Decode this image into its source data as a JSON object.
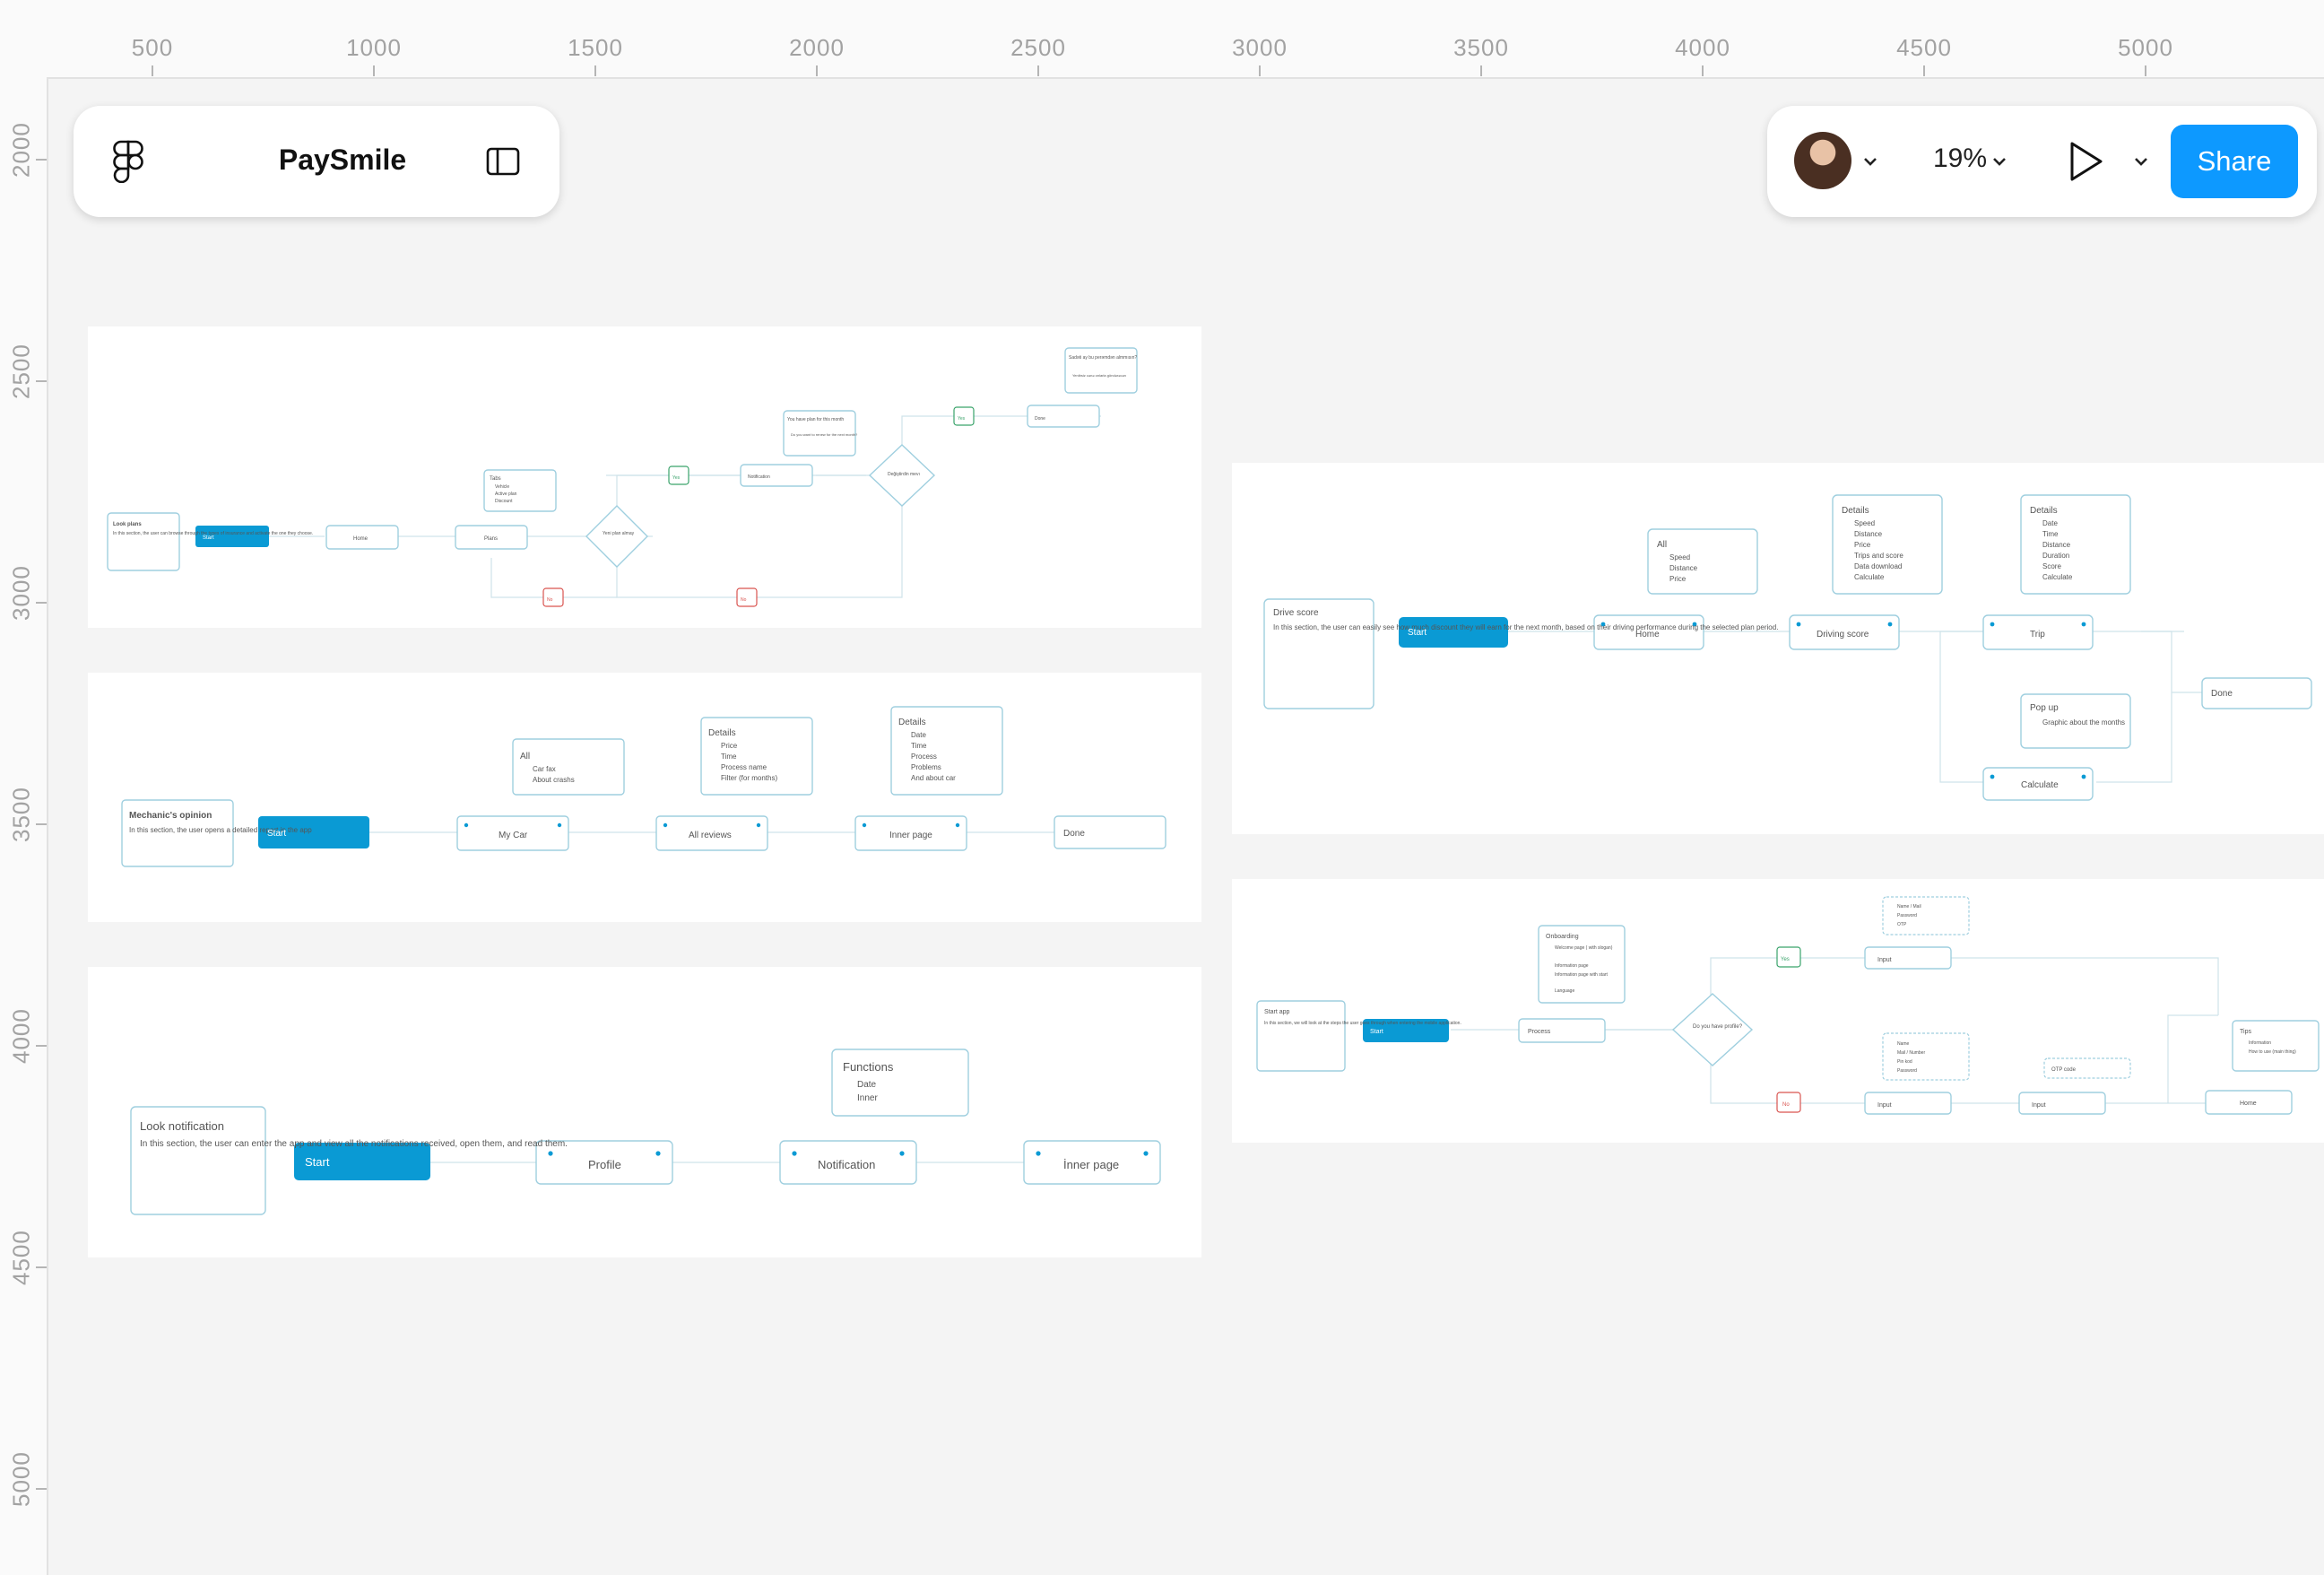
{
  "app": {
    "file_name": "PaySmile",
    "zoom_label": "19%",
    "share_label": "Share",
    "icons": {
      "main_menu": "figma-logo-icon",
      "panel_toggle": "sidebar-toggle-icon",
      "avatar": "user-avatar",
      "avatar_menu": "chevron-down-icon",
      "zoom_menu": "chevron-down-icon",
      "present": "play-icon",
      "present_menu": "chevron-down-icon"
    },
    "colors": {
      "accent": "#0d99ff",
      "canvas": "#f4f4f4",
      "flow_blue": "#0a9ad4",
      "flow_stroke": "#8ec7d9",
      "yes": "#3aa36b",
      "no": "#d9534f"
    }
  },
  "rulers": {
    "x": [
      "500",
      "1000",
      "1500",
      "2000",
      "2500",
      "3000",
      "3500",
      "4000",
      "4500",
      "5000"
    ],
    "y": [
      "2000",
      "2500",
      "3000",
      "3500",
      "4000",
      "4500",
      "5000"
    ]
  },
  "frames": {
    "plans": {
      "note_title": "Look plans",
      "note_text": "In this section, the user can browse through the types of insurance and activate the one they choose.",
      "start": "Start",
      "home": "Home",
      "plans": "Plans",
      "tabs_title": "Tabs",
      "tabs_items": [
        "Vehicle",
        "Active plan",
        "Discount"
      ],
      "decision_1": "Yeni plan almay",
      "yes_1": "Yes",
      "no_1": "No",
      "no_2": "No",
      "notification": "Notification",
      "callout_plan": "You have plan for this month",
      "callout_plan_item": "Do you want to renew for the next month?",
      "decision_2": "Değiştirdin mevı",
      "yes_2": "Yes",
      "done": "Done",
      "callout_done": "Sadəti ay bu perəmdən almmısın?",
      "callout_done_item": "Yenibsiz cənə onlarla göndərəcən"
    },
    "mechanic": {
      "note_title": "Mechanic's opinion",
      "note_text": "In this section, the user opens a detailed report in the app",
      "start": "Start",
      "my_car": "My Car",
      "all_reviews": "All reviews",
      "inner_page": "Inner page",
      "done": "Done",
      "all_title": "All",
      "all_items": [
        "Car fax",
        "About crashs"
      ],
      "details1_title": "Details",
      "details1_items": [
        "Price",
        "Time",
        "Process name",
        "Filter (for months)"
      ],
      "details2_title": "Details",
      "details2_items": [
        "Date",
        "Time",
        "Process",
        "Problems",
        "And about car"
      ]
    },
    "notification": {
      "note_title": "Look notification",
      "note_text": "In this section, the user can enter the app and view all the notifications received, open them, and read them.",
      "start": "Start",
      "profile": "Profile",
      "notification": "Notification",
      "inner_page": "İnner page",
      "functions_title": "Functions",
      "functions_items": [
        "Date",
        "Inner"
      ]
    },
    "drive": {
      "note_title": "Drive score",
      "note_text": "In this section, the user can easily see how much discount they will earn for the next month, based on their driving performance during the selected plan period.",
      "start": "Start",
      "home": "Home",
      "driving_score": "Driving score",
      "trip": "Trip",
      "done": "Done",
      "calculate": "Calculate",
      "all_title": "All",
      "all_items": [
        "Speed",
        "Distance",
        "Price"
      ],
      "details1_title": "Details",
      "details1_items": [
        "Speed",
        "Distance",
        "Price",
        "Trips and score",
        "Data download",
        "Calculate"
      ],
      "details2_title": "Details",
      "details2_items": [
        "Date",
        "Time",
        "Distance",
        "Duration",
        "Score",
        "Calculate"
      ],
      "popup_title": "Pop up",
      "popup_items": [
        "Graphic about the months"
      ]
    },
    "start_app": {
      "note_title": "Start app",
      "note_text": "In this section, we will look at the steps the user goes through when entering the mobile application.",
      "start": "Start",
      "process": "Process",
      "onboarding_title": "Onboarding",
      "onboarding_items": [
        "Welcome page ( with slogan)",
        "Information page",
        "Information page with start",
        "Language"
      ],
      "decision": "Do you have profile?",
      "yes": "Yes",
      "no": "No",
      "input_1": "Input",
      "input_2": "Input",
      "input_3": "Input",
      "login_items": [
        "Name / Mail",
        "Password",
        "OTP"
      ],
      "register_items": [
        "Name",
        "Mail / Number",
        "Pin kod",
        "Password"
      ],
      "otp": "OTP code",
      "tips_title": "Tips",
      "tips_items": [
        "Information",
        "How to use (main thing)"
      ],
      "home": "Home"
    }
  }
}
